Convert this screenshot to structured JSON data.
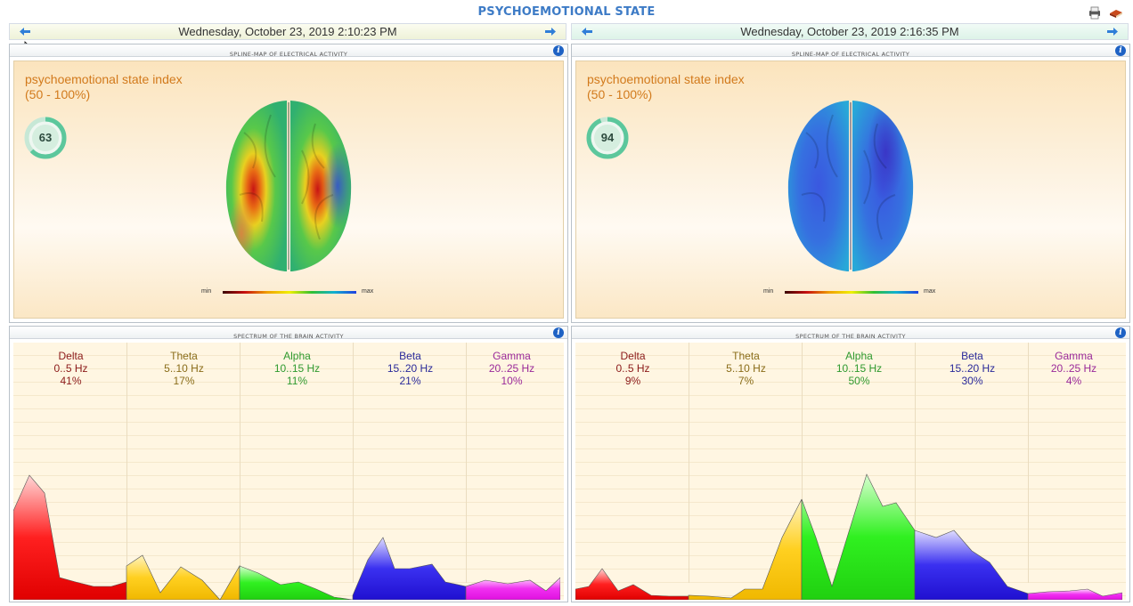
{
  "app": {
    "title": "PSYCHOEMOTIONAL STATE"
  },
  "toolbar": {
    "print_icon": "printer-icon",
    "help_icon": "book-icon"
  },
  "sessions": [
    {
      "date": "Wednesday, October 23, 2019 2:10:23 PM",
      "map": {
        "header": "SPLINE-MAP OF ELECTRICAL ACTIVITY",
        "index_title": "psychoemotional state index",
        "index_range": "(50 - 100%)",
        "index_value": "63",
        "index_fraction": 0.63,
        "scale_min": "min",
        "scale_max": "max"
      },
      "spectrum": {
        "header": "SPECTRUM OF THE BRAIN ACTIVITY",
        "bands": [
          {
            "name": "Delta",
            "range": "0..5 Hz",
            "percent": "41%",
            "color": "#8b1a1a"
          },
          {
            "name": "Theta",
            "range": "5..10 Hz",
            "percent": "17%",
            "color": "#8a6d1a"
          },
          {
            "name": "Alpha",
            "range": "10..15 Hz",
            "percent": "11%",
            "color": "#2f9a2f"
          },
          {
            "name": "Beta",
            "range": "15..20 Hz",
            "percent": "21%",
            "color": "#2a2a9a"
          },
          {
            "name": "Gamma",
            "range": "20..25 Hz",
            "percent": "10%",
            "color": "#9a2a9a"
          }
        ]
      }
    },
    {
      "date": "Wednesday, October 23, 2019 2:16:35 PM",
      "map": {
        "header": "SPLINE-MAP OF ELECTRICAL ACTIVITY",
        "index_title": "psychoemotional state index",
        "index_range": "(50 - 100%)",
        "index_value": "94",
        "index_fraction": 0.94,
        "scale_min": "min",
        "scale_max": "max"
      },
      "spectrum": {
        "header": "SPECTRUM OF THE BRAIN ACTIVITY",
        "bands": [
          {
            "name": "Delta",
            "range": "0..5 Hz",
            "percent": "9%",
            "color": "#8b1a1a"
          },
          {
            "name": "Theta",
            "range": "5..10 Hz",
            "percent": "7%",
            "color": "#8a6d1a"
          },
          {
            "name": "Alpha",
            "range": "10..15 Hz",
            "percent": "50%",
            "color": "#2f9a2f"
          },
          {
            "name": "Beta",
            "range": "15..20 Hz",
            "percent": "30%",
            "color": "#2a2a9a"
          },
          {
            "name": "Gamma",
            "range": "20..25 Hz",
            "percent": "4%",
            "color": "#9a2a9a"
          }
        ]
      }
    }
  ],
  "colors": {
    "title": "#3d7bc6",
    "index_text": "#d27a1c",
    "delta": "#e8000b",
    "theta": "#ffc300",
    "alpha": "#22e01c",
    "beta": "#2a20e0",
    "gamma": "#f020f0"
  }
}
